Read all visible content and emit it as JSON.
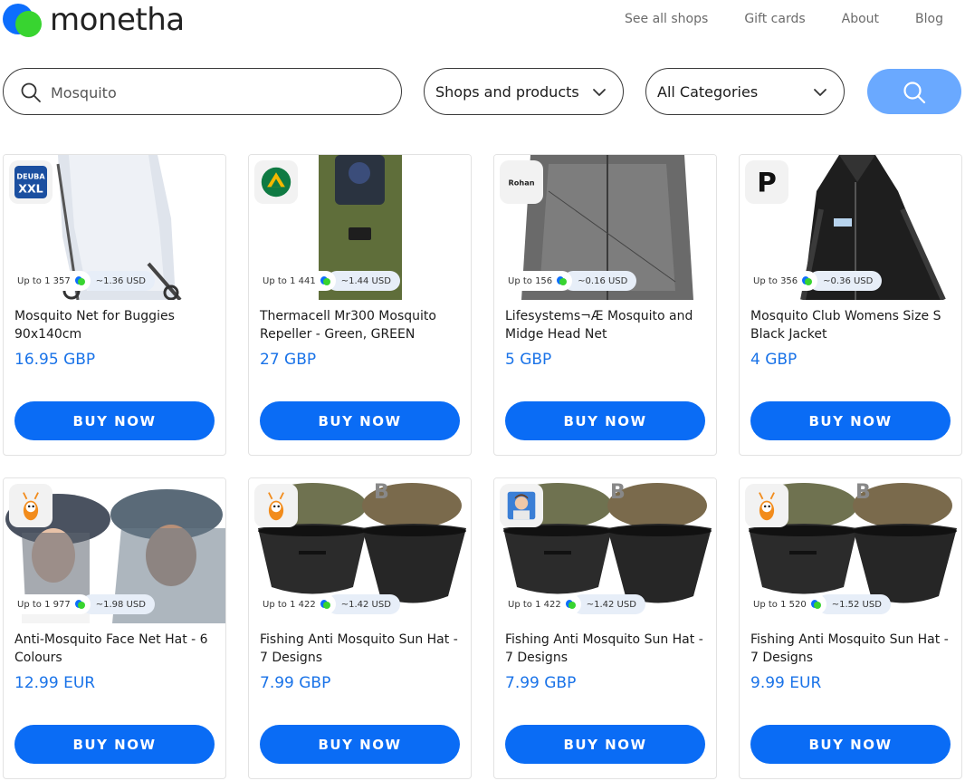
{
  "brand": {
    "name": "monetha",
    "accent": "#0a6cf5",
    "green": "#38d430"
  },
  "nav": [
    "See all shops",
    "Gift cards",
    "About",
    "Blog"
  ],
  "search": {
    "value": "Mosquito",
    "scope": "Shops and products",
    "category": "All Categories"
  },
  "products": [
    {
      "title": "Mosquito Net for Buggies 90x140cm",
      "price": "16.95 GBP",
      "cashback": "Up to 1 357",
      "usd": "~1.36 USD",
      "shop": "DEUBA XXL",
      "button": "BUY NOW"
    },
    {
      "title": "Thermacell Mr300 Mosquito Repeller - Green, GREEN",
      "price": "27 GBP",
      "cashback": "Up to 1 441",
      "usd": "~1.44 USD",
      "shop": "arrow-shop-icon",
      "button": "BUY NOW"
    },
    {
      "title": "Lifesystems¬Æ Mosquito and Midge Head Net",
      "price": "5 GBP",
      "cashback": "Up to 156",
      "usd": "~0.16 USD",
      "shop": "Rohan",
      "button": "BUY NOW"
    },
    {
      "title": "Mosquito Club Womens Size S Black Jacket",
      "price": "4 GBP",
      "cashback": "Up to 356",
      "usd": "~0.36 USD",
      "shop": "P",
      "button": "BUY NOW"
    },
    {
      "title": "Anti-Mosquito Face Net Hat - 6 Colours",
      "price": "12.99 EUR",
      "cashback": "Up to 1 977",
      "usd": "~1.98 USD",
      "shop": "bee-mascot-icon",
      "button": "BUY NOW"
    },
    {
      "title": "Fishing Anti Mosquito Sun Hat - 7 Designs",
      "price": "7.99 GBP",
      "cashback": "Up to 1 422",
      "usd": "~1.42 USD",
      "shop": "bee-mascot-icon",
      "button": "BUY NOW"
    },
    {
      "title": "Fishing Anti Mosquito Sun Hat - 7 Designs",
      "price": "7.99 GBP",
      "cashback": "Up to 1 422",
      "usd": "~1.42 USD",
      "shop": "avatar-shop-icon",
      "button": "BUY NOW"
    },
    {
      "title": "Fishing Anti Mosquito Sun Hat - 7 Designs",
      "price": "9.99 EUR",
      "cashback": "Up to 1 520",
      "usd": "~1.52 USD",
      "shop": "bee-mascot-icon",
      "button": "BUY NOW"
    }
  ]
}
